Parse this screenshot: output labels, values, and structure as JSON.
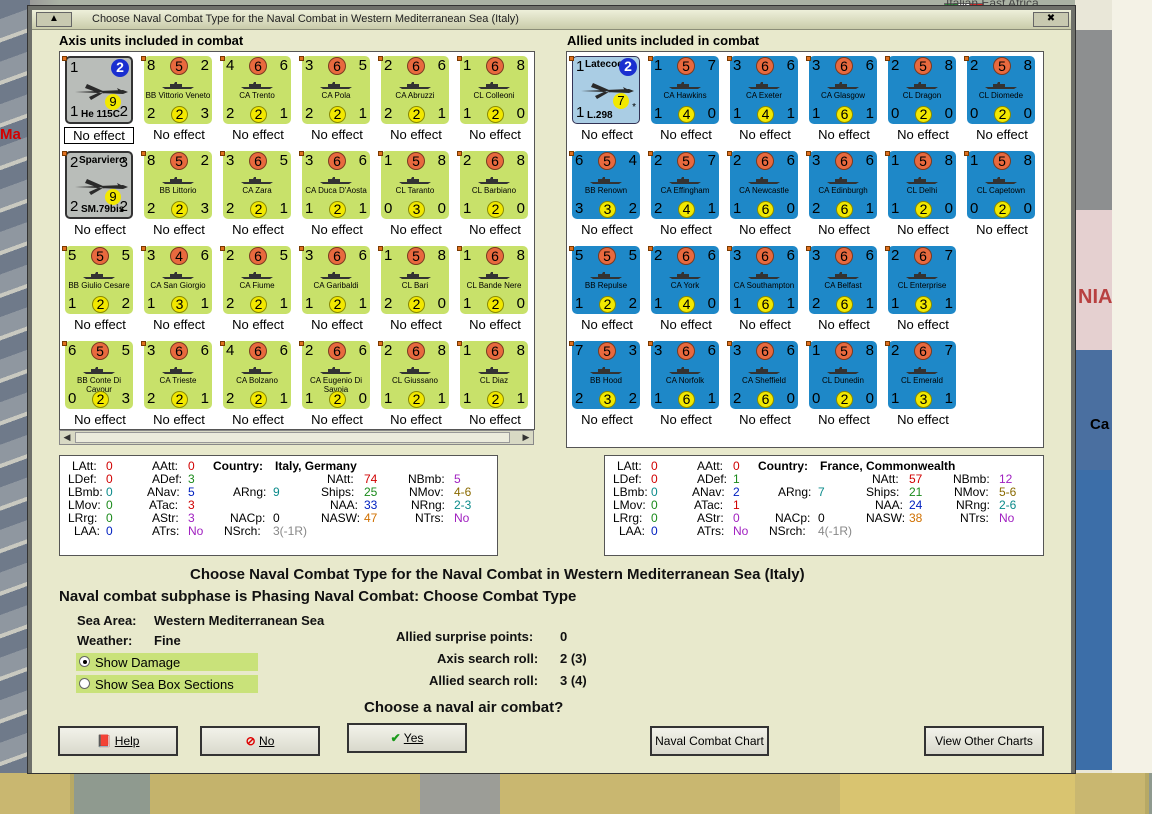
{
  "window": {
    "title": "Choose Naval Combat Type for the Naval Combat in Western Mediterranean Sea (Italy)",
    "topright_text": "Italian East Africa"
  },
  "map": {
    "left_label": "Ma",
    "right_label": "NIA",
    "right_label2": "Ca"
  },
  "axis": {
    "panel_title": "Axis units included in combat",
    "units": [
      {
        "kind": "air",
        "name": "He 115C",
        "tl": "1",
        "bc": "2",
        "yc": "9",
        "bl": "1",
        "br": "2",
        "effect": "No effect",
        "selected": true
      },
      {
        "kind": "ship",
        "name": "BB Vittorio Veneto",
        "tl": "8",
        "c": "5",
        "tr": "2",
        "bl": "2",
        "y": "2",
        "br": "3",
        "effect": "No effect"
      },
      {
        "kind": "ship",
        "name": "CA Trento",
        "tl": "4",
        "c": "6",
        "tr": "6",
        "bl": "2",
        "y": "2",
        "br": "1",
        "effect": "No effect"
      },
      {
        "kind": "ship",
        "name": "CA Pola",
        "tl": "3",
        "c": "6",
        "tr": "5",
        "bl": "2",
        "y": "2",
        "br": "1",
        "effect": "No effect"
      },
      {
        "kind": "ship",
        "name": "CA Abruzzi",
        "tl": "2",
        "c": "6",
        "tr": "6",
        "bl": "2",
        "y": "2",
        "br": "1",
        "effect": "No effect"
      },
      {
        "kind": "ship",
        "name": "CL Colleoni",
        "tl": "1",
        "c": "6",
        "tr": "8",
        "bl": "1",
        "y": "2",
        "br": "0",
        "effect": "No effect"
      },
      {
        "kind": "air",
        "name": "SM.79bis",
        "name2": "Sparviero",
        "tl": "2",
        "tr": "3",
        "yc": "9",
        "bl": "2",
        "br": "2",
        "effect": "No effect"
      },
      {
        "kind": "ship",
        "name": "BB Littorio",
        "tl": "8",
        "c": "5",
        "tr": "2",
        "bl": "2",
        "y": "2",
        "br": "3",
        "effect": "No effect"
      },
      {
        "kind": "ship",
        "name": "CA Zara",
        "tl": "3",
        "c": "6",
        "tr": "5",
        "bl": "2",
        "y": "2",
        "br": "1",
        "effect": "No effect"
      },
      {
        "kind": "ship",
        "name": "CA Duca D'Aosta",
        "tl": "3",
        "c": "6",
        "tr": "6",
        "bl": "1",
        "y": "2",
        "br": "1",
        "effect": "No effect"
      },
      {
        "kind": "ship",
        "name": "CL Taranto",
        "tl": "1",
        "c": "5",
        "tr": "8",
        "bl": "0",
        "y": "3",
        "br": "0",
        "effect": "No effect"
      },
      {
        "kind": "ship",
        "name": "CL Barbiano",
        "tl": "2",
        "c": "6",
        "tr": "8",
        "bl": "1",
        "y": "2",
        "br": "0",
        "effect": "No effect"
      },
      {
        "kind": "ship",
        "name": "BB Giulio Cesare",
        "tl": "5",
        "c": "5",
        "tr": "5",
        "bl": "1",
        "y": "2",
        "br": "2",
        "effect": "No effect"
      },
      {
        "kind": "ship",
        "name": "CA San Giorgio",
        "tl": "3",
        "c": "4",
        "tr": "6",
        "bl": "1",
        "y": "3",
        "br": "1",
        "effect": "No effect"
      },
      {
        "kind": "ship",
        "name": "CA Fiume",
        "tl": "2",
        "c": "6",
        "tr": "5",
        "bl": "2",
        "y": "2",
        "br": "1",
        "effect": "No effect"
      },
      {
        "kind": "ship",
        "name": "CA Garibaldi",
        "tl": "3",
        "c": "6",
        "tr": "6",
        "bl": "1",
        "y": "2",
        "br": "1",
        "effect": "No effect"
      },
      {
        "kind": "ship",
        "name": "CL Bari",
        "tl": "1",
        "c": "5",
        "tr": "8",
        "bl": "2",
        "y": "2",
        "br": "0",
        "effect": "No effect"
      },
      {
        "kind": "ship",
        "name": "CL Bande Nere",
        "tl": "1",
        "c": "6",
        "tr": "8",
        "bl": "1",
        "y": "2",
        "br": "0",
        "effect": "No effect"
      },
      {
        "kind": "ship",
        "name": "BB Conte Di Cavour",
        "tl": "6",
        "c": "5",
        "tr": "5",
        "bl": "0",
        "y": "2",
        "br": "3",
        "effect": "No effect"
      },
      {
        "kind": "ship",
        "name": "CA Trieste",
        "tl": "3",
        "c": "6",
        "tr": "6",
        "bl": "2",
        "y": "2",
        "br": "1",
        "effect": "No effect"
      },
      {
        "kind": "ship",
        "name": "CA Bolzano",
        "tl": "4",
        "c": "6",
        "tr": "6",
        "bl": "2",
        "y": "2",
        "br": "1",
        "effect": "No effect"
      },
      {
        "kind": "ship",
        "name": "CA Eugenio Di Savoia",
        "tl": "2",
        "c": "6",
        "tr": "6",
        "bl": "1",
        "y": "2",
        "br": "0",
        "effect": "No effect"
      },
      {
        "kind": "ship",
        "name": "CL Giussano",
        "tl": "2",
        "c": "6",
        "tr": "8",
        "bl": "1",
        "y": "2",
        "br": "1",
        "effect": "No effect"
      },
      {
        "kind": "ship",
        "name": "CL Diaz",
        "tl": "1",
        "c": "6",
        "tr": "8",
        "bl": "1",
        "y": "2",
        "br": "1",
        "effect": "No effect"
      }
    ],
    "stats": {
      "LAtt": "0",
      "LDef": "0",
      "LBmb": "0",
      "LMov": "0",
      "LRrg": "0",
      "LAA": "0",
      "AAtt": "0",
      "ADef": "3",
      "ANav": "5",
      "ATac": "3",
      "AStr": "3",
      "ATrs": "No",
      "country_label": "Country:",
      "country": "Italy, Germany",
      "ARng": "9",
      "NACp": "0",
      "NSrch": "3(-1R)",
      "NAtt": "74",
      "Ships": "25",
      "NAA": "33",
      "NASW": "47",
      "NBmb": "5",
      "NMov": "4-6",
      "NRng": "2-3",
      "NTrs": "No"
    }
  },
  "allied": {
    "panel_title": "Allied units included in combat",
    "units": [
      {
        "kind": "air",
        "name": "L.298",
        "name2": "Latecoere",
        "tl": "1",
        "bc": "2",
        "yc": "7",
        "bl": "1",
        "star": "*",
        "effect": "No effect"
      },
      {
        "kind": "ship",
        "name": "CA Hawkins",
        "tl": "1",
        "c": "5",
        "tr": "7",
        "bl": "1",
        "y": "4",
        "br": "0",
        "effect": "No effect"
      },
      {
        "kind": "ship",
        "name": "CA Exeter",
        "tl": "3",
        "c": "6",
        "tr": "6",
        "bl": "1",
        "y": "4",
        "br": "1",
        "effect": "No effect"
      },
      {
        "kind": "ship",
        "name": "CA Glasgow",
        "tl": "3",
        "c": "6",
        "tr": "6",
        "bl": "1",
        "y": "6",
        "br": "1",
        "effect": "No effect"
      },
      {
        "kind": "ship",
        "name": "CL Dragon",
        "tl": "2",
        "c": "5",
        "tr": "8",
        "bl": "0",
        "y": "2",
        "br": "0",
        "effect": "No effect"
      },
      {
        "kind": "ship",
        "name": "CL Diomede",
        "tl": "2",
        "c": "5",
        "tr": "8",
        "bl": "0",
        "y": "2",
        "br": "0",
        "effect": "No effect"
      },
      {
        "kind": "ship",
        "name": "BB Renown",
        "tl": "6",
        "c": "5",
        "tr": "4",
        "bl": "3",
        "y": "3",
        "br": "2",
        "effect": "No effect"
      },
      {
        "kind": "ship",
        "name": "CA Effingham",
        "tl": "2",
        "c": "5",
        "tr": "7",
        "bl": "2",
        "y": "4",
        "br": "1",
        "effect": "No effect"
      },
      {
        "kind": "ship",
        "name": "CA Newcastle",
        "tl": "2",
        "c": "6",
        "tr": "6",
        "bl": "1",
        "y": "6",
        "br": "0",
        "effect": "No effect"
      },
      {
        "kind": "ship",
        "name": "CA Edinburgh",
        "tl": "3",
        "c": "6",
        "tr": "6",
        "bl": "2",
        "y": "6",
        "br": "1",
        "effect": "No effect"
      },
      {
        "kind": "ship",
        "name": "CL Delhi",
        "tl": "1",
        "c": "5",
        "tr": "8",
        "bl": "1",
        "y": "2",
        "br": "0",
        "effect": "No effect"
      },
      {
        "kind": "ship",
        "name": "CL Capetown",
        "tl": "1",
        "c": "5",
        "tr": "8",
        "bl": "0",
        "y": "2",
        "br": "0",
        "effect": "No effect"
      },
      {
        "kind": "ship",
        "name": "BB Repulse",
        "tl": "5",
        "c": "5",
        "tr": "5",
        "bl": "1",
        "y": "2",
        "br": "2",
        "effect": "No effect"
      },
      {
        "kind": "ship",
        "name": "CA York",
        "tl": "2",
        "c": "6",
        "tr": "6",
        "bl": "1",
        "y": "4",
        "br": "0",
        "effect": "No effect"
      },
      {
        "kind": "ship",
        "name": "CA Southampton",
        "tl": "3",
        "c": "6",
        "tr": "6",
        "bl": "1",
        "y": "6",
        "br": "1",
        "effect": "No effect"
      },
      {
        "kind": "ship",
        "name": "CA Belfast",
        "tl": "3",
        "c": "6",
        "tr": "6",
        "bl": "2",
        "y": "6",
        "br": "1",
        "effect": "No effect"
      },
      {
        "kind": "ship",
        "name": "CL Enterprise",
        "tl": "2",
        "c": "6",
        "tr": "7",
        "bl": "1",
        "y": "3",
        "br": "1",
        "effect": "No effect"
      },
      null,
      {
        "kind": "ship",
        "name": "BB Hood",
        "tl": "7",
        "c": "5",
        "tr": "3",
        "bl": "2",
        "y": "3",
        "br": "2",
        "effect": "No effect"
      },
      {
        "kind": "ship",
        "name": "CA Norfolk",
        "tl": "3",
        "c": "6",
        "tr": "6",
        "bl": "1",
        "y": "6",
        "br": "1",
        "effect": "No effect"
      },
      {
        "kind": "ship",
        "name": "CA Sheffield",
        "tl": "3",
        "c": "6",
        "tr": "6",
        "bl": "2",
        "y": "6",
        "br": "0",
        "effect": "No effect"
      },
      {
        "kind": "ship",
        "name": "CL Dunedin",
        "tl": "1",
        "c": "5",
        "tr": "8",
        "bl": "0",
        "y": "2",
        "br": "0",
        "effect": "No effect"
      },
      {
        "kind": "ship",
        "name": "CL Emerald",
        "tl": "2",
        "c": "6",
        "tr": "7",
        "bl": "1",
        "y": "3",
        "br": "1",
        "effect": "No effect"
      }
    ],
    "stats": {
      "LAtt": "0",
      "LDef": "0",
      "LBmb": "0",
      "LMov": "0",
      "LRrg": "0",
      "LAA": "0",
      "AAtt": "0",
      "ADef": "1",
      "ANav": "2",
      "ATac": "1",
      "AStr": "0",
      "ATrs": "No",
      "country_label": "Country:",
      "country": "France, Commonwealth",
      "ARng": "7",
      "NACp": "0",
      "NSrch": "4(-1R)",
      "NAtt": "57",
      "Ships": "21",
      "NAA": "24",
      "NASW": "38",
      "NBmb": "12",
      "NMov": "5-6",
      "NRng": "2-6",
      "NTrs": "No"
    }
  },
  "combat": {
    "heading": "Choose Naval Combat Type for the Naval Combat in Western Mediterranean Sea (Italy)",
    "subphase": "Naval combat subphase is Phasing Naval Combat: Choose Combat Type",
    "sea_area_label": "Sea Area:",
    "sea_area": "Western Mediterranean Sea",
    "weather_label": "Weather:",
    "weather": "Fine",
    "surprise_label": "Allied surprise points:",
    "surprise": "0",
    "axis_search_label": "Axis search roll:",
    "axis_search": "2 (3)",
    "allied_search_label": "Allied search roll:",
    "allied_search": "3 (4)",
    "question": "Choose a naval air combat?",
    "show_damage": "Show Damage",
    "show_sea_box": "Show Sea Box Sections"
  },
  "buttons": {
    "help": "Help",
    "no": "No",
    "yes": "Yes",
    "naval_chart": "Naval Combat Chart",
    "other_charts": "View Other Charts"
  },
  "colors": {
    "axis_counter": "#c8e16a",
    "allied_counter": "#1e88c8",
    "combat_circle": "#e8693e",
    "dialog_bg": "#e5e6c9"
  }
}
